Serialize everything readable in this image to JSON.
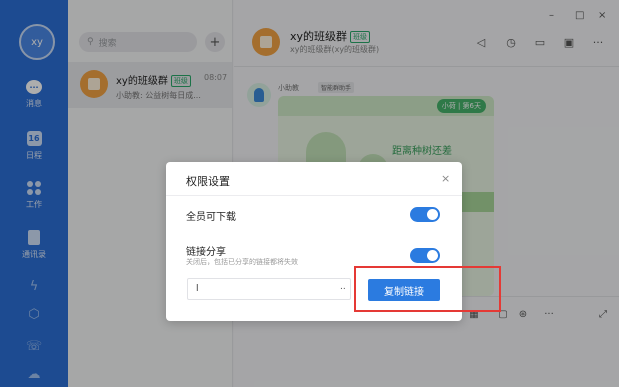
{
  "sidebar": {
    "avatar_text": "xy",
    "items": [
      {
        "label": "消息",
        "icon": "chat-icon"
      },
      {
        "label": "日程",
        "icon": "calendar-icon",
        "badge": "16"
      },
      {
        "label": "工作",
        "icon": "apps-icon"
      },
      {
        "label": "通讯录",
        "icon": "contacts-icon"
      }
    ],
    "extra_icons": [
      "lightning-icon",
      "hexagon-icon",
      "phone-icon",
      "cloud-icon"
    ]
  },
  "conversation_list": {
    "search_placeholder": "搜索",
    "add_label": "+",
    "items": [
      {
        "name": "xy的班级群",
        "tag": "班级",
        "time": "08:07",
        "preview": "小助教: 公益树每日成..."
      }
    ]
  },
  "chat": {
    "title": "xy的班级群",
    "tag": "班级",
    "subtitle": "xy的班级群(xy的班级群)",
    "window_controls": [
      "–",
      "□",
      "×"
    ],
    "message": {
      "sender": "小助教",
      "sender_tag": "智能群助手",
      "card_day": "小荷 | 第6天",
      "card_headline": "距离种树还差"
    },
    "toolbar_more": "···"
  },
  "dialog": {
    "title": "权限设置",
    "close": "×",
    "option_download": {
      "label": "全员可下载",
      "enabled": true
    },
    "option_share": {
      "label": "链接分享",
      "description": "关闭后，包括已分享的链接都将失效",
      "enabled": true
    },
    "link_value": "l",
    "link_ellipsis": "..",
    "copy_button": "复制链接"
  },
  "colors": {
    "rail": "#2b6fd6",
    "accent": "#2b7be0",
    "highlight": "#e53935"
  }
}
